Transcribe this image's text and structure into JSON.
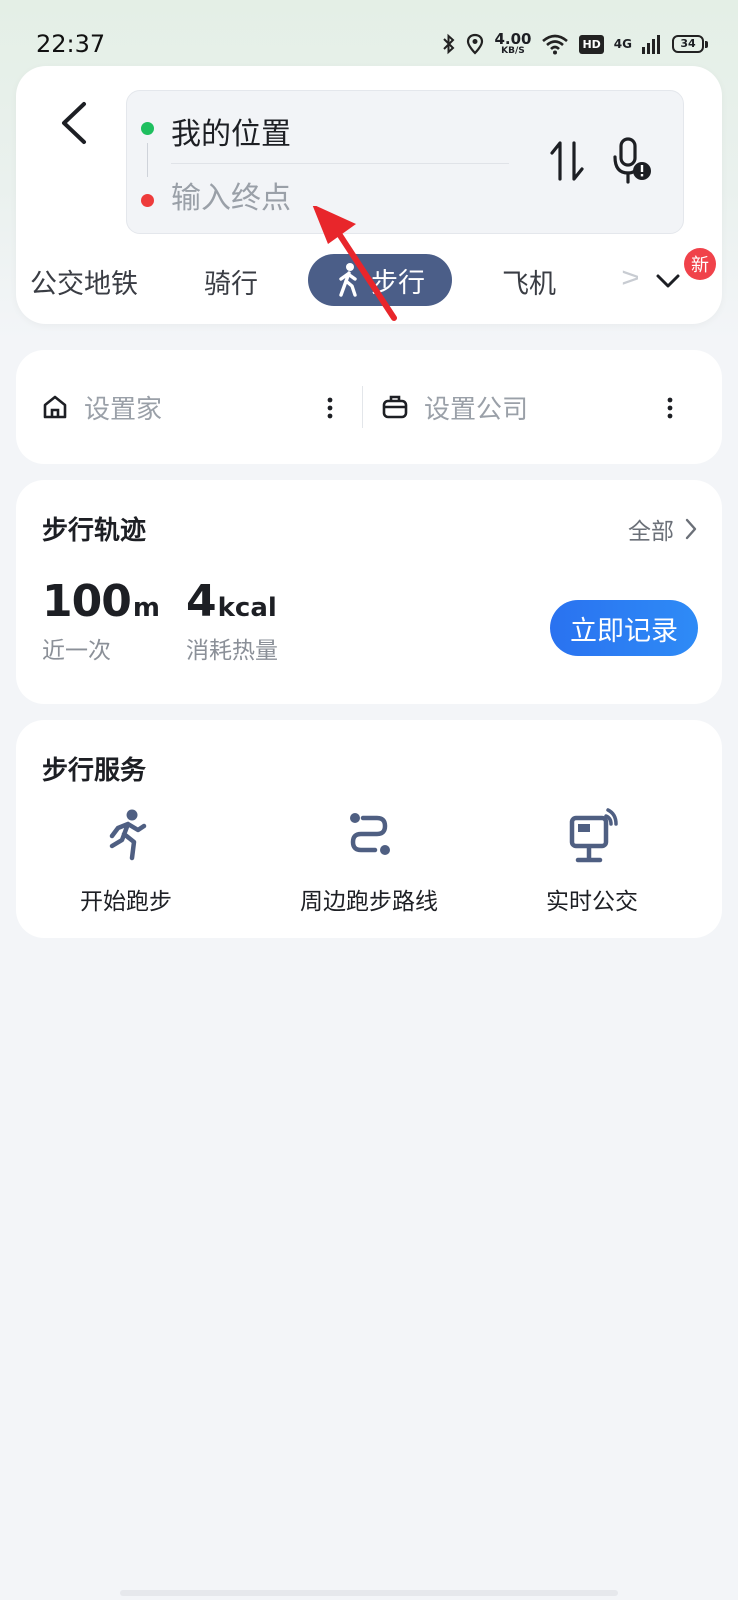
{
  "status": {
    "time": "22:37",
    "speed_value": "4.00",
    "speed_unit": "KB/S",
    "hd": "HD",
    "network": "4G",
    "battery": "34"
  },
  "route": {
    "origin": "我的位置",
    "destination_placeholder": "输入终点"
  },
  "modes": {
    "transit": "公交地铁",
    "cycling": "骑行",
    "walking": "步行",
    "plane": "飞机",
    "more_badge": "新"
  },
  "places": {
    "home": "设置家",
    "company": "设置公司"
  },
  "track": {
    "title": "步行轨迹",
    "all": "全部",
    "distance_value": "100",
    "distance_unit": "m",
    "distance_caption": "近一次",
    "calorie_value": "4",
    "calorie_unit": "kcal",
    "calorie_caption": "消耗热量",
    "record_button": "立即记录"
  },
  "services": {
    "title": "步行服务",
    "items": [
      {
        "label": "开始跑步",
        "icon": "running-icon"
      },
      {
        "label": "周边跑步路线",
        "icon": "route-icon"
      },
      {
        "label": "实时公交",
        "icon": "bus-station-icon"
      }
    ]
  },
  "colors": {
    "active_tab": "#4b5e88",
    "primary_button": "#2a72f0",
    "origin_dot": "#1fbf5f",
    "destination_dot": "#ee3b3b",
    "annotation_arrow": "#e8262b",
    "badge": "#f0424a"
  }
}
